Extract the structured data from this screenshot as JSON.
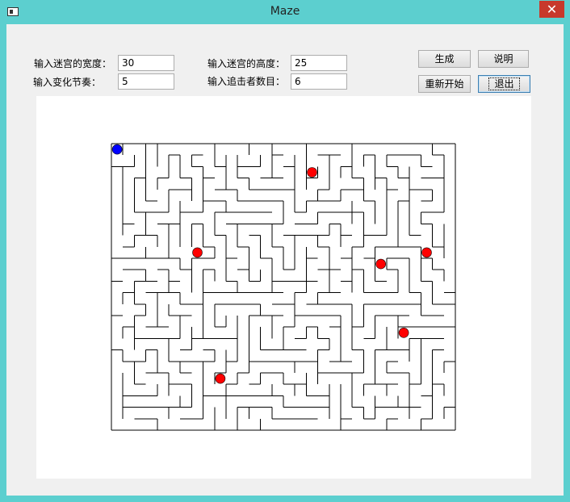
{
  "window": {
    "title": "Maze",
    "close_glyph": "✕"
  },
  "form": {
    "width_label": "输入迷宫的宽度：",
    "width_value": "30",
    "height_label": "输入迷宫的高度：",
    "height_value": "25",
    "rhythm_label": "输入变化节奏：",
    "rhythm_value": "5",
    "chasers_label": "输入追击者数目：",
    "chasers_value": "6"
  },
  "buttons": {
    "generate": "生成",
    "help": "说明",
    "restart": "重新开始",
    "exit": "退出"
  },
  "maze": {
    "cols": 30,
    "rows": 25,
    "player_color": "#0000ff",
    "chaser_color": "#ff0000",
    "player_cell": [
      0,
      0
    ],
    "chaser_cells": [
      [
        17,
        2
      ],
      [
        7,
        9
      ],
      [
        23,
        10
      ],
      [
        27,
        9
      ],
      [
        25,
        16
      ],
      [
        9,
        20
      ]
    ]
  }
}
